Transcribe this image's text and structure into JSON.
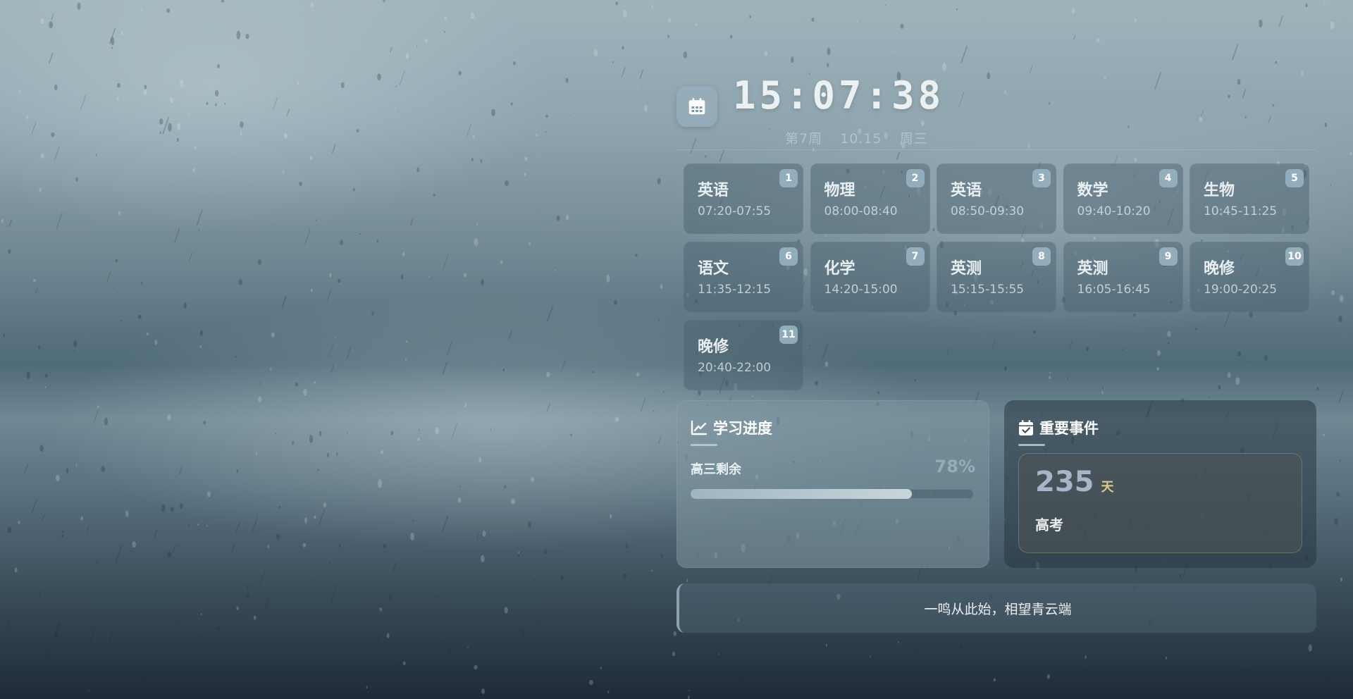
{
  "header": {
    "time": "15:07:38",
    "week": "第7周",
    "date": "10.15",
    "weekday": "周三",
    "calendar_icon": "calendar-icon"
  },
  "schedule": [
    {
      "index": "1",
      "subject": "英语",
      "time": "07:20-07:55"
    },
    {
      "index": "2",
      "subject": "物理",
      "time": "08:00-08:40"
    },
    {
      "index": "3",
      "subject": "英语",
      "time": "08:50-09:30"
    },
    {
      "index": "4",
      "subject": "数学",
      "time": "09:40-10:20"
    },
    {
      "index": "5",
      "subject": "生物",
      "time": "10:45-11:25"
    },
    {
      "index": "6",
      "subject": "语文",
      "time": "11:35-12:15"
    },
    {
      "index": "7",
      "subject": "化学",
      "time": "14:20-15:00"
    },
    {
      "index": "8",
      "subject": "英测",
      "time": "15:15-15:55"
    },
    {
      "index": "9",
      "subject": "英测",
      "time": "16:05-16:45"
    },
    {
      "index": "10",
      "subject": "晚修",
      "time": "19:00-20:25"
    },
    {
      "index": "11",
      "subject": "晚修",
      "time": "20:40-22:00"
    }
  ],
  "progress": {
    "title": "学习进度",
    "icon": "line-chart-icon",
    "label": "高三剩余",
    "percent_text": "78%",
    "value": 0.78,
    "fill_color": "#c8d6dc"
  },
  "events": {
    "title": "重要事件",
    "icon": "calendar-check-icon",
    "days": "235",
    "unit": "天",
    "name": "高考",
    "accent": "#d8c98a"
  },
  "quote": {
    "text": "一鸣从此始，相望青云端"
  }
}
